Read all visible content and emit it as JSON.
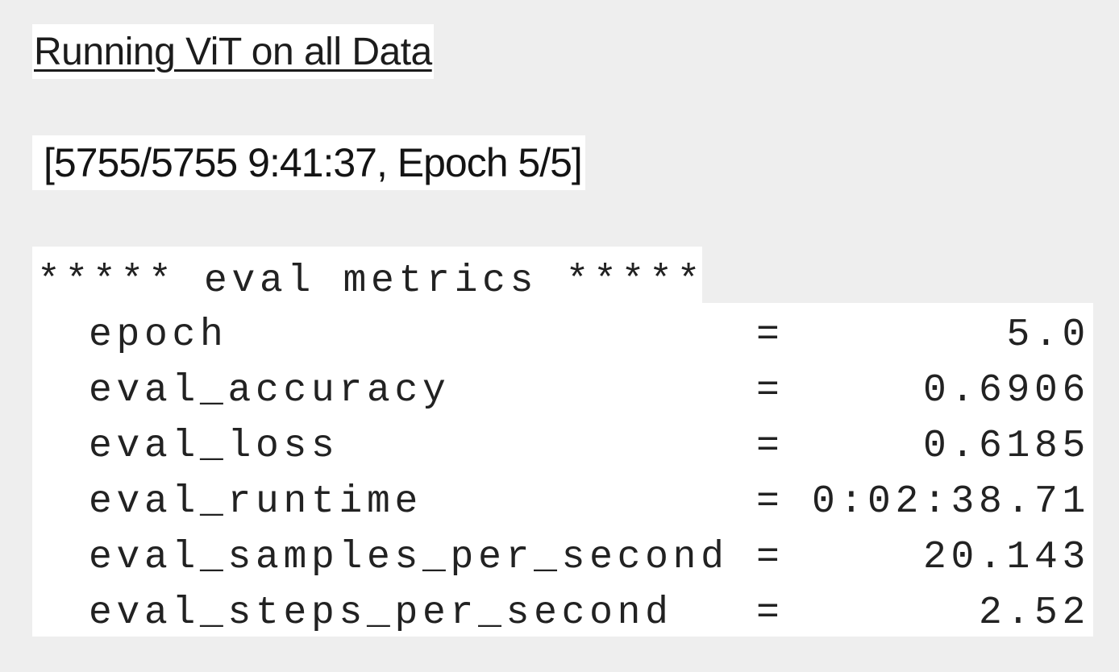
{
  "title": "Running ViT on all Data",
  "progress": "[5755/5755 9:41:37, Epoch 5/5]",
  "metrics_header": "***** eval metrics *****",
  "metrics": [
    {
      "name": "epoch",
      "eq": "=",
      "value": "5.0"
    },
    {
      "name": "eval_accuracy",
      "eq": "=",
      "value": "0.6906"
    },
    {
      "name": "eval_loss",
      "eq": "=",
      "value": "0.6185"
    },
    {
      "name": "eval_runtime",
      "eq": "=",
      "value": "0:02:38.71"
    },
    {
      "name": "eval_samples_per_second",
      "eq": "=",
      "value": "20.143"
    },
    {
      "name": "eval_steps_per_second",
      "eq": "=",
      "value": "2.52"
    }
  ],
  "colors": {
    "background": "#eeeeee",
    "panel": "#ffffff",
    "text": "#222222"
  }
}
